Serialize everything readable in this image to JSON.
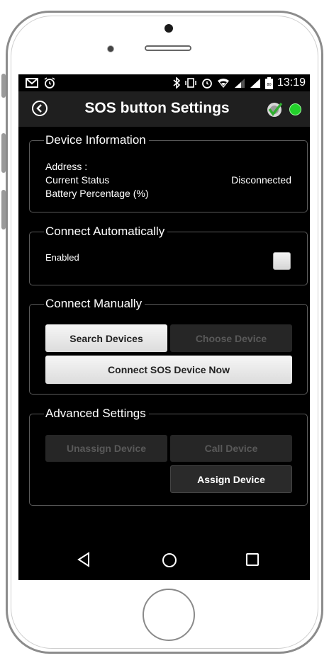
{
  "statusbar": {
    "time": "13:19",
    "battery": "80",
    "left_icons": [
      "gmail-icon",
      "alarm-icon"
    ],
    "right_icons": [
      "bluetooth-icon",
      "vibrate-icon",
      "alarm-icon",
      "wifi-icon",
      "signal-icon",
      "signal-icon",
      "battery-icon"
    ]
  },
  "appbar": {
    "title": "SOS button Settings",
    "back_icon": "back-circle-icon",
    "status_color": "#22d12a"
  },
  "device_info": {
    "legend": "Device Information",
    "address_label": "Address :",
    "status_label": "Current Status",
    "status_value": "Disconnected",
    "battery_label": "Battery Percentage (%)"
  },
  "connect_auto": {
    "legend": "Connect Automatically",
    "enabled_label": "Enabled",
    "checked": false
  },
  "connect_manual": {
    "legend": "Connect Manually",
    "search_button": "Search Devices",
    "choose_button": "Choose Device",
    "connect_button": "Connect SOS Device Now"
  },
  "advanced": {
    "legend": "Advanced Settings",
    "unassign_button": "Unassign Device",
    "call_button": "Call Device",
    "assign_button": "Assign Device"
  },
  "nav": {
    "icons": [
      "nav-back-icon",
      "nav-home-icon",
      "nav-recent-icon"
    ]
  }
}
